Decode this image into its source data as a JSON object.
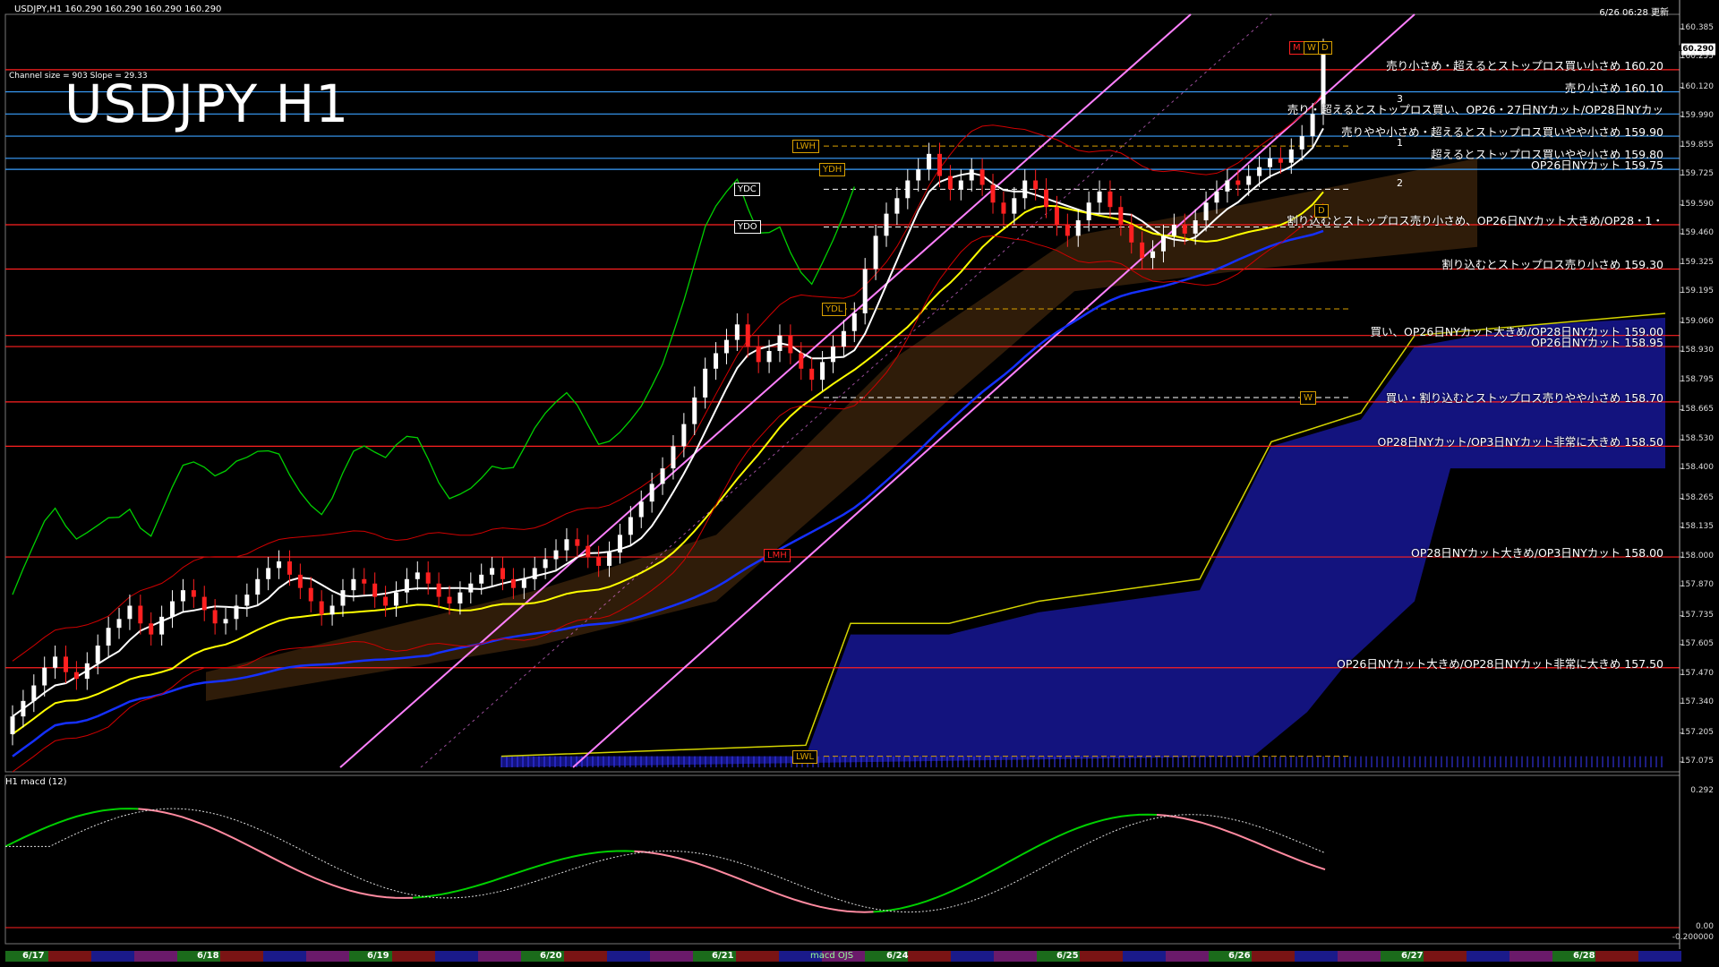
{
  "header": {
    "symbol_info": "USDJPY,H1  160.290 160.290 160.290 160.290",
    "timestamp": "6/26 06:28 更新",
    "channel_info": "Channel size = 903 Slope = 29.33",
    "title": "USDJPY H1",
    "macd_label": "H1  macd (12)"
  },
  "price_axis": [
    {
      "v": 160.385,
      "t": "160.385"
    },
    {
      "v": 160.255,
      "t": "160.255"
    },
    {
      "v": 160.12,
      "t": "160.120"
    },
    {
      "v": 159.99,
      "t": "159.990"
    },
    {
      "v": 159.855,
      "t": "159.855"
    },
    {
      "v": 159.725,
      "t": "159.725"
    },
    {
      "v": 159.59,
      "t": "159.590"
    },
    {
      "v": 159.46,
      "t": "159.460"
    },
    {
      "v": 159.325,
      "t": "159.325"
    },
    {
      "v": 159.195,
      "t": "159.195"
    },
    {
      "v": 159.06,
      "t": "159.060"
    },
    {
      "v": 158.93,
      "t": "158.930"
    },
    {
      "v": 158.795,
      "t": "158.795"
    },
    {
      "v": 158.665,
      "t": "158.665"
    },
    {
      "v": 158.53,
      "t": "158.530"
    },
    {
      "v": 158.4,
      "t": "158.400"
    },
    {
      "v": 158.265,
      "t": "158.265"
    },
    {
      "v": 158.135,
      "t": "158.135"
    },
    {
      "v": 158.0,
      "t": "158.000"
    },
    {
      "v": 157.87,
      "t": "157.870"
    },
    {
      "v": 157.735,
      "t": "157.735"
    },
    {
      "v": 157.605,
      "t": "157.605"
    },
    {
      "v": 157.47,
      "t": "157.470"
    },
    {
      "v": 157.34,
      "t": "157.340"
    },
    {
      "v": 157.205,
      "t": "157.205"
    },
    {
      "v": 157.075,
      "t": "157.075"
    }
  ],
  "current_price": "160.290",
  "macd_axis": {
    "top": "0.292",
    "zero": "0.00",
    "bottom": "-0.200000"
  },
  "dates": [
    "6/17",
    "6/18",
    "6/19",
    "6/20",
    "6/21",
    "6/24",
    "6/25",
    "6/26",
    "6/27",
    "6/28"
  ],
  "date_scroll_label": "macd OJS",
  "levels": [
    {
      "price": 160.2,
      "color": "#ff2020",
      "text": "売り小さめ・超えるとストップロス買い小さめ 160.20"
    },
    {
      "price": 160.1,
      "color": "#3aa0ff",
      "text": "売り小さめ 160.10"
    },
    {
      "price": 160.0,
      "color": "#3aa0ff",
      "text": "売り・超えるとストップロス買い、OP26・27日NYカット/OP28日NYカッ"
    },
    {
      "price": 159.9,
      "color": "#3aa0ff",
      "text": "売りやや小さめ・超えるとストップロス買いやや小さめ 159.90"
    },
    {
      "price": 159.8,
      "color": "#3aa0ff",
      "text": "超えるとストップロス買いやや小さめ 159.80"
    },
    {
      "price": 159.75,
      "color": "#3aa0ff",
      "text": "OP26日NYカット 159.75"
    },
    {
      "price": 159.5,
      "color": "#ff2020",
      "text": "割り込むとストップロス売り小さめ、OP26日NYカット大きめ/OP28・1・"
    },
    {
      "price": 159.3,
      "color": "#ff2020",
      "text": "割り込むとストップロス売り小さめ 159.30"
    },
    {
      "price": 159.0,
      "color": "#ff2020",
      "text": "買い、OP26日NYカット大きめ/OP28日NYカット 159.00"
    },
    {
      "price": 158.95,
      "color": "#ff2020",
      "text": "OP26日NYカット 158.95"
    },
    {
      "price": 158.7,
      "color": "#ff2020",
      "text": "買い・割り込むとストップロス売りやや小さめ 158.70"
    },
    {
      "price": 158.5,
      "color": "#ff2020",
      "text": "OP28日NYカット/OP3日NYカット非常に大きめ 158.50"
    },
    {
      "price": 158.0,
      "color": "#ff2020",
      "text": "OP28日NYカット大きめ/OP3日NYカット 158.00"
    },
    {
      "price": 157.5,
      "color": "#ff2020",
      "text": "OP26日NYカット大きめ/OP28日NYカット非常に大きめ 157.50"
    }
  ],
  "tags": [
    {
      "label": "LWH",
      "price": 159.855,
      "color": "#d9a000"
    },
    {
      "label": "YDH",
      "price": 159.75,
      "color": "#d9a000"
    },
    {
      "label": "YDC",
      "price": 159.66,
      "color": "#ffffff"
    },
    {
      "label": "YDO",
      "price": 159.49,
      "color": "#ffffff"
    },
    {
      "label": "YDL",
      "price": 159.12,
      "color": "#d9a000"
    },
    {
      "label": "LMH",
      "price": 158.01,
      "color": "#ff2020"
    },
    {
      "label": "LWL",
      "price": 157.1,
      "color": "#d9a000"
    },
    {
      "label": "W",
      "price": 158.72,
      "color": "#d9a000"
    },
    {
      "label": "D",
      "price": 159.565,
      "color": "#d9a000"
    },
    {
      "label": "M",
      "price": 160.3,
      "color": "#ff2020"
    },
    {
      "label": "W",
      "price": 160.3,
      "color": "#d9a000"
    },
    {
      "label": "D",
      "price": 160.3,
      "color": "#d9a000"
    }
  ],
  "wave_labels": [
    "3",
    "1",
    "2"
  ],
  "colors": {
    "level_red": "#ff2020",
    "level_blue": "#3aa0ff",
    "kumo": "#1a1aa8",
    "sma_fast": "#ffffff",
    "sma_mid": "#ffff00",
    "sma_slow": "#1530ff",
    "channel": "#ff80ff",
    "chikou": "#00d000",
    "macd_up": "#00d000",
    "macd_down": "#ff8aa0"
  },
  "chart_data": {
    "type": "candlestick",
    "title": "USDJPY H1",
    "ylim": [
      157.03,
      160.45
    ],
    "close": [
      157.28,
      157.35,
      157.42,
      157.5,
      157.55,
      157.48,
      157.45,
      157.52,
      157.6,
      157.68,
      157.72,
      157.78,
      157.7,
      157.65,
      157.73,
      157.8,
      157.85,
      157.82,
      157.76,
      157.7,
      157.72,
      157.78,
      157.83,
      157.9,
      157.95,
      157.98,
      157.92,
      157.86,
      157.8,
      157.74,
      157.78,
      157.85,
      157.9,
      157.88,
      157.82,
      157.78,
      157.84,
      157.9,
      157.93,
      157.88,
      157.82,
      157.79,
      157.84,
      157.88,
      157.92,
      157.95,
      157.9,
      157.86,
      157.9,
      157.95,
      157.99,
      158.03,
      158.08,
      158.05,
      158.0,
      157.96,
      158.02,
      158.1,
      158.18,
      158.25,
      158.33,
      158.4,
      158.5,
      158.6,
      158.72,
      158.85,
      158.92,
      158.98,
      159.05,
      158.95,
      158.88,
      158.93,
      159.0,
      158.92,
      158.85,
      158.8,
      158.88,
      158.95,
      159.02,
      159.1,
      159.3,
      159.45,
      159.55,
      159.62,
      159.7,
      159.75,
      159.82,
      159.72,
      159.66,
      159.7,
      159.75,
      159.68,
      159.6,
      159.55,
      159.62,
      159.7,
      159.66,
      159.58,
      159.5,
      159.45,
      159.52,
      159.6,
      159.65,
      159.58,
      159.5,
      159.42,
      159.35,
      159.38,
      159.45,
      159.5,
      159.46,
      159.52,
      159.6,
      159.65,
      159.7,
      159.68,
      159.72,
      159.76,
      159.8,
      159.78,
      159.84,
      159.9,
      160.0,
      160.29
    ]
  }
}
